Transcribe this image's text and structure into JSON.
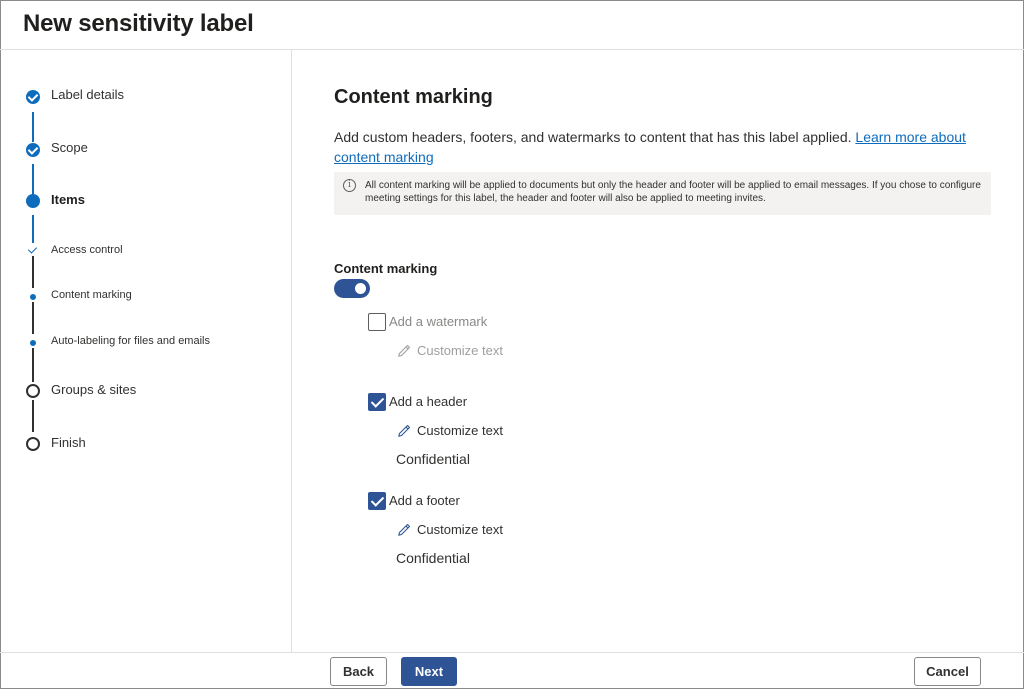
{
  "header": {
    "title": "New sensitivity label"
  },
  "sidebar": {
    "steps": [
      {
        "label": "Label details",
        "state": "completed"
      },
      {
        "label": "Scope",
        "state": "completed"
      },
      {
        "label": "Items",
        "state": "current"
      },
      {
        "label": "Access control",
        "state": "completed-substep"
      },
      {
        "label": "Content marking",
        "state": "current-substep"
      },
      {
        "label": "Auto-labeling for files and emails",
        "state": "pending-substep"
      },
      {
        "label": "Groups & sites",
        "state": "pending"
      },
      {
        "label": "Finish",
        "state": "pending"
      }
    ]
  },
  "main": {
    "title": "Content marking",
    "description": "Add custom headers, footers, and watermarks to content that has this label applied.",
    "learn_more_link": "Learn more about content marking",
    "info_text": "All content marking will be applied to documents but only the header and footer will be applied to email messages. If you chose to configure meeting settings for this label, the header and footer will also be applied to meeting invites.",
    "toggle": {
      "label": "Content marking",
      "on": true
    },
    "options": {
      "watermark": {
        "label": "Add a watermark",
        "checked": false,
        "customize": "Customize text"
      },
      "header": {
        "label": "Add a header",
        "checked": true,
        "customize": "Customize text",
        "value": "Confidential"
      },
      "footer": {
        "label": "Add a footer",
        "checked": true,
        "customize": "Customize text",
        "value": "Confidential"
      }
    }
  },
  "footer": {
    "back_label": "Back",
    "next_label": "Next",
    "cancel_label": "Cancel"
  },
  "colors": {
    "accent": "#0f6cbd",
    "primary_button": "#2f5496"
  }
}
